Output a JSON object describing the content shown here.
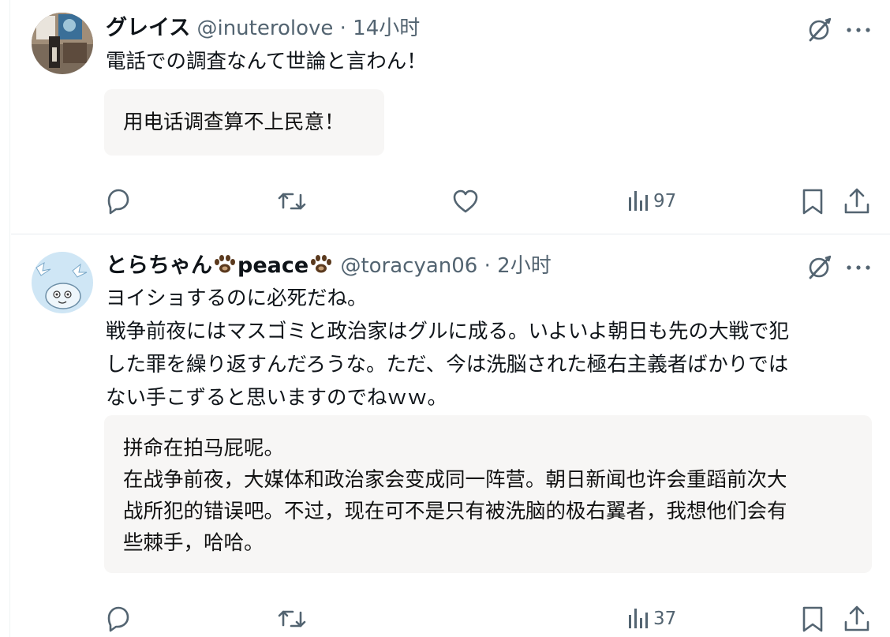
{
  "posts": [
    {
      "author_name": "グレイス",
      "handle_time": "@inuterolove · 14小时",
      "text_lines": [
        "電話での調査なんて世論と言わん！"
      ],
      "translation_lines": [
        "用电话调查算不上民意！"
      ],
      "views": "97"
    },
    {
      "author_name": "とらちゃん",
      "author_suffix": "peace",
      "handle_time": "@toracyan06 · 2小时",
      "text_lines": [
        "ヨイショするのに必死だね。",
        "戦争前夜にはマスゴミと政治家はグルに成る。いよいよ朝日も先の大戦で犯",
        "した罪を繰り返すんだろうな。ただ、今は洗脳された極右主義者ばかりでは",
        "ない手こずると思いますのでねｗｗ。"
      ],
      "translation_lines": [
        "拼命在拍马屁呢。",
        "在战争前夜，大媒体和政治家会变成同一阵营。朝日新闻也许会重蹈前次大",
        "战所犯的错误吧。不过，现在可不是只有被洗脑的极右翼者，我想他们会有",
        "些棘手，哈哈。"
      ],
      "views": "37"
    }
  ],
  "icons": {
    "grok": "grok-icon",
    "more": "more-icon",
    "reply": "reply-icon",
    "repost": "repost-icon",
    "like": "like-icon",
    "views": "views-icon",
    "bookmark": "bookmark-icon",
    "share": "share-icon"
  },
  "colors": {
    "text": "#0f1419",
    "secondary": "#536471",
    "translation_bg": "#f7f6f5",
    "paw": "#5b3a1e"
  }
}
